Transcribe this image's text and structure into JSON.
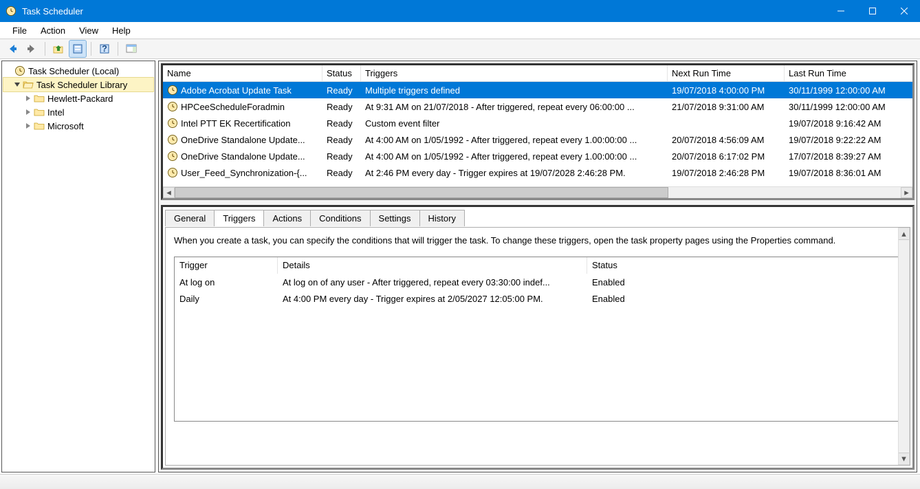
{
  "window": {
    "title": "Task Scheduler"
  },
  "menu": {
    "file": "File",
    "action": "Action",
    "view": "View",
    "help": "Help"
  },
  "tree": {
    "root": "Task Scheduler (Local)",
    "library": "Task Scheduler Library",
    "children": [
      "Hewlett-Packard",
      "Intel",
      "Microsoft"
    ]
  },
  "grid": {
    "headers": {
      "name": "Name",
      "status": "Status",
      "triggers": "Triggers",
      "next": "Next Run Time",
      "last": "Last Run Time"
    },
    "rows": [
      {
        "name": "Adobe Acrobat Update Task",
        "status": "Ready",
        "triggers": "Multiple triggers defined",
        "next": "19/07/2018 4:00:00 PM",
        "last": "30/11/1999 12:00:00 AM"
      },
      {
        "name": "HPCeeScheduleForadmin",
        "status": "Ready",
        "triggers": "At 9:31 AM on 21/07/2018 - After triggered, repeat every 06:00:00 ...",
        "next": "21/07/2018 9:31:00 AM",
        "last": "30/11/1999 12:00:00 AM"
      },
      {
        "name": "Intel PTT EK Recertification",
        "status": "Ready",
        "triggers": "Custom event filter",
        "next": "",
        "last": "19/07/2018 9:16:42 AM"
      },
      {
        "name": "OneDrive Standalone Update...",
        "status": "Ready",
        "triggers": "At 4:00 AM on 1/05/1992 - After triggered, repeat every 1.00:00:00 ...",
        "next": "20/07/2018 4:56:09 AM",
        "last": "19/07/2018 9:22:22 AM"
      },
      {
        "name": "OneDrive Standalone Update...",
        "status": "Ready",
        "triggers": "At 4:00 AM on 1/05/1992 - After triggered, repeat every 1.00:00:00 ...",
        "next": "20/07/2018 6:17:02 PM",
        "last": "17/07/2018 8:39:27 AM"
      },
      {
        "name": "User_Feed_Synchronization-{...",
        "status": "Ready",
        "triggers": "At 2:46 PM every day - Trigger expires at 19/07/2028 2:46:28 PM.",
        "next": "19/07/2018 2:46:28 PM",
        "last": "19/07/2018 8:36:01 AM"
      }
    ]
  },
  "tabs": {
    "general": "General",
    "triggers": "Triggers",
    "actions": "Actions",
    "conditions": "Conditions",
    "settings": "Settings",
    "history": "History"
  },
  "triggers_tab": {
    "desc": "When you create a task, you can specify the conditions that will trigger the task.  To change these triggers, open the task property pages using the Properties command.",
    "headers": {
      "trigger": "Trigger",
      "details": "Details",
      "status": "Status"
    },
    "rows": [
      {
        "trigger": "At log on",
        "details": "At log on of any user - After triggered, repeat every 03:30:00 indef...",
        "status": "Enabled"
      },
      {
        "trigger": "Daily",
        "details": "At 4:00 PM every day - Trigger expires at 2/05/2027 12:05:00 PM.",
        "status": "Enabled"
      }
    ]
  }
}
